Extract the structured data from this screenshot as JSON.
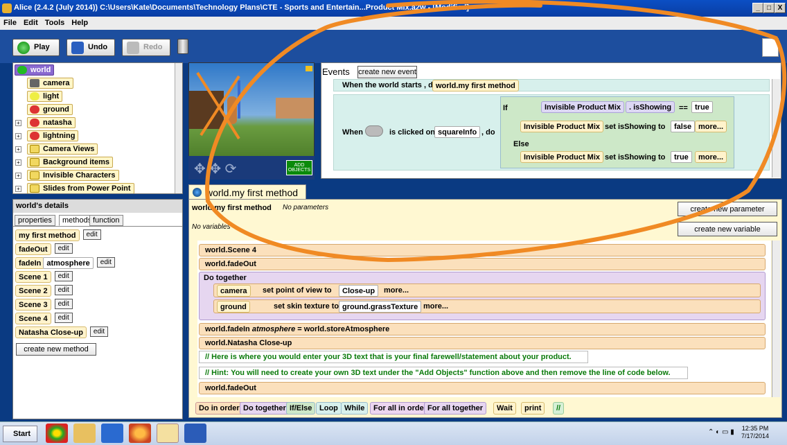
{
  "window": {
    "title": "Alice (2.4.2 (July 2014)) C:\\Users\\Kate\\Documents\\Technology Plans\\CTE - Sports and Entertain...Product Mix.a2w - [Modified]",
    "min": "_",
    "max": "□",
    "close": "X"
  },
  "menu": [
    "File",
    "Edit",
    "Tools",
    "Help"
  ],
  "toolbar": {
    "play": "Play",
    "undo": "Undo",
    "redo": "Redo"
  },
  "tree": {
    "items": [
      "world",
      "camera",
      "light",
      "ground",
      "natasha",
      "lightning",
      "Camera Views",
      "Background items",
      "Invisible Characters",
      "Slides from Power Point"
    ]
  },
  "scene": {
    "add_objects": "ADD OBJECTS"
  },
  "events": {
    "label": "Events",
    "create_btn": "create new event",
    "row1": {
      "when": "When the world starts , do",
      "method": "world.my first method"
    },
    "row2": {
      "when": "When",
      "clicked": "is clicked on",
      "target": "squareInfo",
      "do": ", do",
      "if": "If",
      "obj": "Invisible Product Mix",
      "prop": ". isShowing",
      "eq": "==",
      "true": "true",
      "set1": "set isShowing to",
      "false": "false",
      "more": "more...",
      "else": "Else",
      "set2": "set isShowing to",
      "true2": "true"
    }
  },
  "details": {
    "header": "world's details",
    "tabs": [
      "properties",
      "methods",
      "function"
    ],
    "methods": [
      {
        "name": "my first method",
        "param": ""
      },
      {
        "name": "fadeOut",
        "param": ""
      },
      {
        "name": "fadeIn",
        "param": "atmosphere"
      },
      {
        "name": "Scene 1",
        "param": ""
      },
      {
        "name": "Scene 2",
        "param": ""
      },
      {
        "name": "Scene 3",
        "param": ""
      },
      {
        "name": "Scene 4",
        "param": ""
      },
      {
        "name": "Natasha Close-up",
        "param": ""
      }
    ],
    "edit": "edit",
    "create": "create new method"
  },
  "editor": {
    "tab": "world.my first method",
    "method": "world.my first method",
    "params": "No parameters",
    "vars": "No variables",
    "create_param": "create new parameter",
    "create_var": "create new variable",
    "lines": {
      "s1": "world.Scene 4",
      "s2": "world.fadeOut",
      "dotogether": "Do together",
      "cam": "camera",
      "cam_set": "set point of view to",
      "closeup": "Close-up",
      "more": "more...",
      "ground": "ground",
      "ground_set": "set skin texture to",
      "grass": "ground.grassTexture",
      "fadein": "world.fadeIn",
      "atmo": "atmosphere",
      "atmo_eq": "= world.storeAtmosphere",
      "natasha": "world.Natasha Close-up",
      "c1": "//  Here is where you would enter your 3D text that is your final farewell/statement about your product.",
      "c2": "//  Hint: You will need to create your own 3D text under the \"Add Objects\" function above and then remove the line of code below.",
      "s_last": "world.fadeOut"
    }
  },
  "bottom": [
    "Do in order",
    "Do together",
    "If/Else",
    "Loop",
    "While",
    "For all in order",
    "For all together",
    "Wait",
    "print",
    "//"
  ],
  "taskbar": {
    "start": "Start",
    "time": "12:35 PM",
    "date": "7/17/2014"
  },
  "colors": {
    "title_blue": "#0a3da3",
    "panel_blue": "#1d4e9e",
    "annotation_orange": "#f08a24"
  }
}
